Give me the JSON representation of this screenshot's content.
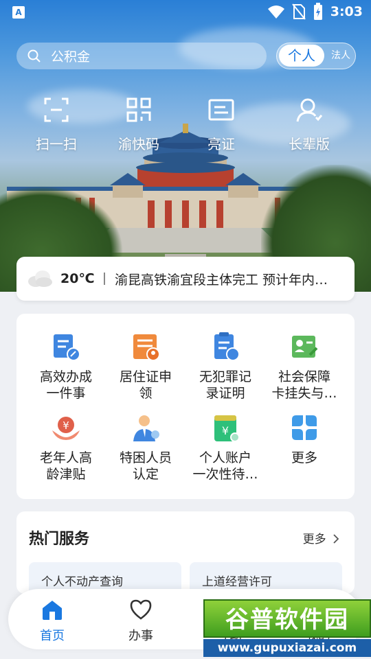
{
  "status_bar": {
    "time": "3:03",
    "app_badge": "A"
  },
  "search": {
    "placeholder": "公积金"
  },
  "segment": {
    "active": "个人",
    "inactive": "法人"
  },
  "quick_actions": [
    {
      "label": "扫一扫",
      "icon": "scan-icon"
    },
    {
      "label": "渝快码",
      "icon": "qrcode-icon"
    },
    {
      "label": "亮证",
      "icon": "id-card-icon"
    },
    {
      "label": "长辈版",
      "icon": "elder-icon"
    }
  ],
  "news": {
    "temperature": "20℃",
    "weather_icon": "cloudy-icon",
    "headline": "渝昆高铁渝宜段主体完工 预计年内…"
  },
  "services": [
    {
      "line1": "高效办成",
      "line2": "一件事",
      "icon": "efficiency-icon",
      "color": "#3f86e0"
    },
    {
      "line1": "居住证申",
      "line2": "领",
      "icon": "residence-permit-icon",
      "color": "#f08a3c"
    },
    {
      "line1": "无犯罪记",
      "line2": "录证明",
      "icon": "no-criminal-record-icon",
      "color": "#3f86e0"
    },
    {
      "line1": "社会保障",
      "line2": "卡挂失与…",
      "icon": "social-security-card-icon",
      "color": "#5cb85c"
    },
    {
      "line1": "老年人高",
      "line2": "龄津贴",
      "icon": "elderly-allowance-icon",
      "color": "#e0604a"
    },
    {
      "line1": "特困人员",
      "line2": "认定",
      "icon": "poverty-person-icon",
      "color": "#3f86e0"
    },
    {
      "line1": "个人账户",
      "line2": "一次性待…",
      "icon": "personal-account-icon",
      "color": "#2ec07a"
    },
    {
      "line1": "更多",
      "line2": "",
      "icon": "more-grid-icon",
      "color": "#3f9be8"
    }
  ],
  "hot": {
    "title": "热门服务",
    "more": "更多",
    "item1": "个人不动产查询",
    "item2": "上道经营许可"
  },
  "nav": [
    {
      "label": "首页",
      "icon": "home-icon"
    },
    {
      "label": "办事",
      "icon": "heart-icon"
    },
    {
      "label": "互动",
      "icon": "chat-icon"
    },
    {
      "label": "我的",
      "icon": "profile-icon"
    }
  ],
  "watermark": {
    "title": "谷普软件园",
    "url": "www.gupuxiazai.com"
  }
}
